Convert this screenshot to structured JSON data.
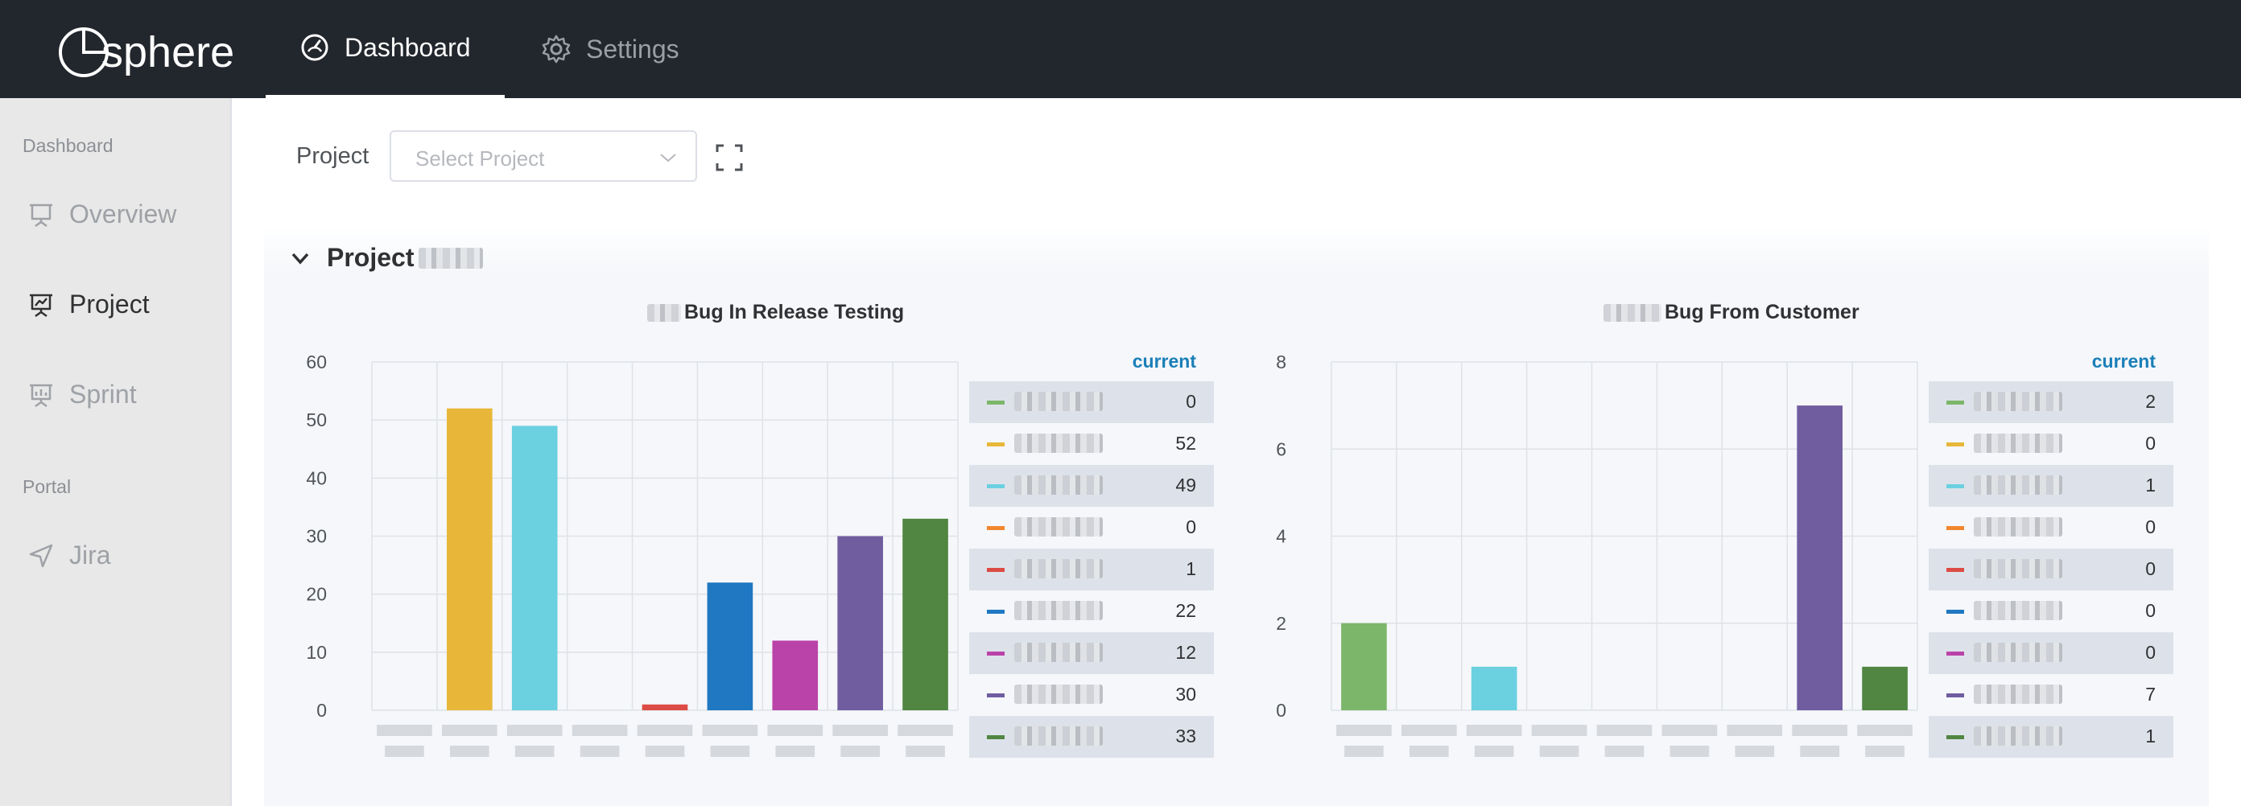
{
  "app": {
    "name": "sphere"
  },
  "topnav": {
    "tabs": [
      {
        "label": "Dashboard",
        "icon": "gauge-icon",
        "active": true
      },
      {
        "label": "Settings",
        "icon": "gear-icon",
        "active": false
      }
    ]
  },
  "sidebar": {
    "group1": "Dashboard",
    "items": [
      {
        "label": "Overview",
        "icon": "presentation-board-icon",
        "active": false
      },
      {
        "label": "Project",
        "icon": "presentation-chart-icon",
        "active": true
      },
      {
        "label": "Sprint",
        "icon": "presentation-chart-icon",
        "active": false
      }
    ],
    "group2": "Portal",
    "portal_items": [
      {
        "label": "Jira",
        "icon": "send-arrow-icon",
        "active": false
      }
    ]
  },
  "filters": {
    "project_label": "Project",
    "project_placeholder": "Select Project"
  },
  "panel": {
    "title": "Project"
  },
  "colors": {
    "green_light": "#7cb66a",
    "yellow": "#e8b73a",
    "cyan": "#6bd0e0",
    "orange": "#f2862f",
    "red": "#dd4b45",
    "blue": "#1f78c1",
    "magenta": "#ba43a9",
    "purple": "#705da0",
    "green_dark": "#508642",
    "legend_header": "#1a7fb8"
  },
  "chart_data": [
    {
      "type": "bar",
      "title": "Bug In Release Testing",
      "ylim": [
        0,
        60
      ],
      "yticks": [
        0,
        10,
        20,
        30,
        40,
        50,
        60
      ],
      "grid": true,
      "legend_header": "current",
      "legend_placement": "right",
      "series": [
        {
          "color_key": "green_light",
          "values": [
            0
          ]
        },
        {
          "color_key": "yellow",
          "values": [
            52
          ]
        },
        {
          "color_key": "cyan",
          "values": [
            49
          ]
        },
        {
          "color_key": "orange",
          "values": [
            0
          ]
        },
        {
          "color_key": "red",
          "values": [
            1
          ]
        },
        {
          "color_key": "blue",
          "values": [
            22
          ]
        },
        {
          "color_key": "magenta",
          "values": [
            12
          ]
        },
        {
          "color_key": "purple",
          "values": [
            30
          ]
        },
        {
          "color_key": "green_dark",
          "values": [
            33
          ]
        }
      ]
    },
    {
      "type": "bar",
      "title": "Bug From Customer",
      "ylim": [
        0,
        8
      ],
      "yticks": [
        0,
        2,
        4,
        6,
        8
      ],
      "grid": true,
      "legend_header": "current",
      "legend_placement": "right",
      "series": [
        {
          "color_key": "green_light",
          "values": [
            2
          ]
        },
        {
          "color_key": "yellow",
          "values": [
            0
          ]
        },
        {
          "color_key": "cyan",
          "values": [
            1
          ]
        },
        {
          "color_key": "orange",
          "values": [
            0
          ]
        },
        {
          "color_key": "red",
          "values": [
            0
          ]
        },
        {
          "color_key": "blue",
          "values": [
            0
          ]
        },
        {
          "color_key": "magenta",
          "values": [
            0
          ]
        },
        {
          "color_key": "purple",
          "values": [
            7
          ]
        },
        {
          "color_key": "green_dark",
          "values": [
            1
          ]
        }
      ]
    }
  ]
}
